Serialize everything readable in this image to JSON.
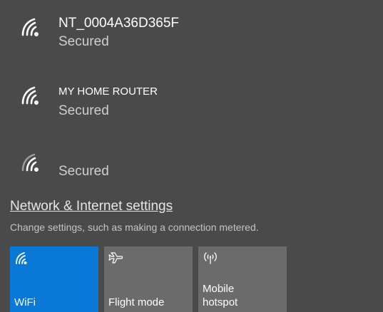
{
  "networks": [
    {
      "name": "NT_0004A36D365F",
      "status": "Secured",
      "icon": "wifi-signal-icon"
    },
    {
      "name": "MY HOME ROUTER",
      "status": "Secured",
      "icon": "wifi-signal-icon"
    },
    {
      "name": "",
      "status": "Secured",
      "icon": "wifi-signal-icon"
    }
  ],
  "settings": {
    "link_label": "Network & Internet settings",
    "description": "Change settings, such as making a connection metered."
  },
  "quick_actions": [
    {
      "label": "WiFi",
      "icon": "wifi-icon",
      "active": true
    },
    {
      "label": "Flight mode",
      "icon": "airplane-icon",
      "active": false
    },
    {
      "label": "Mobile\nhotspot",
      "icon": "mobile-hotspot-icon",
      "active": false
    }
  ],
  "colors": {
    "panel_background": "#4a4a4a",
    "tile_background": "#6b6b6b",
    "tile_active": "#0a78d7",
    "secondary_text": "#cfcfcf"
  }
}
